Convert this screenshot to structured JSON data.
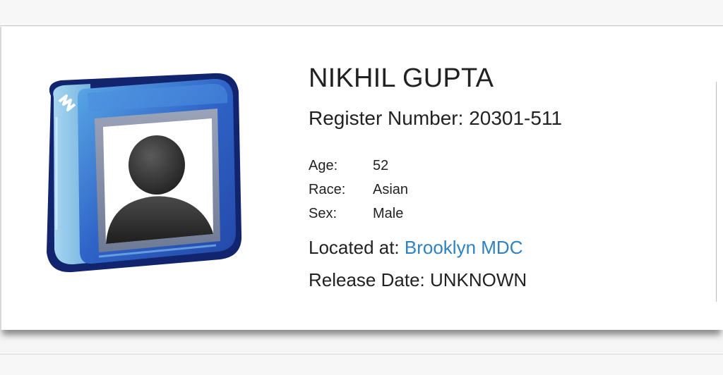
{
  "inmate": {
    "name": "NIKHIL GUPTA",
    "register_label": "Register Number:",
    "register_number": "20301-511",
    "details": [
      {
        "label": "Age:",
        "value": "52"
      },
      {
        "label": "Race:",
        "value": "Asian"
      },
      {
        "label": "Sex:",
        "value": "Male"
      }
    ],
    "located_label": "Located at:",
    "location": "Brooklyn MDC",
    "release_label": "Release Date:",
    "release_date": "UNKNOWN"
  },
  "icons": {
    "photo": "person-silhouette-icon"
  },
  "colors": {
    "link": "#2f82c2",
    "text": "#222222",
    "icon_frame": "#2f5fc0",
    "icon_frame_dark": "#13246e",
    "icon_frame_light": "#8fc4e6",
    "icon_silhouette": "#2b2b2b"
  }
}
